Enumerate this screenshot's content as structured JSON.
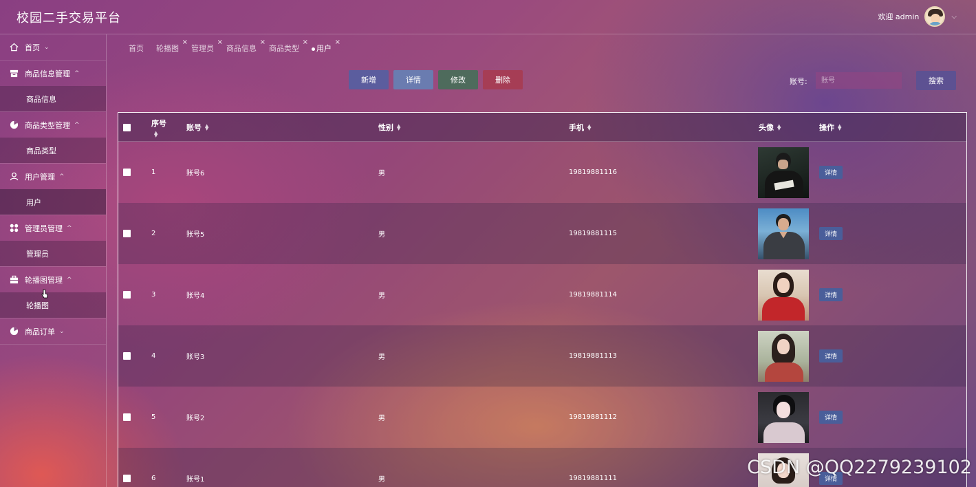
{
  "header": {
    "title": "校园二手交易平台",
    "welcome": "欢迎 admin"
  },
  "sidebar": {
    "items": [
      {
        "label": "首页",
        "icon": "home-icon",
        "expanded": false,
        "children": []
      },
      {
        "label": "商品信息管理",
        "icon": "box-icon",
        "expanded": true,
        "children": [
          "商品信息"
        ]
      },
      {
        "label": "商品类型管理",
        "icon": "pie-icon",
        "expanded": true,
        "children": [
          "商品类型"
        ]
      },
      {
        "label": "用户管理",
        "icon": "user-icon",
        "expanded": true,
        "children": [
          "用户"
        ]
      },
      {
        "label": "管理员管理",
        "icon": "grid-icon",
        "expanded": true,
        "children": [
          "管理员"
        ]
      },
      {
        "label": "轮播图管理",
        "icon": "briefcase-icon",
        "expanded": true,
        "children": [
          "轮播图"
        ]
      },
      {
        "label": "商品订单",
        "icon": "pie-icon",
        "expanded": false,
        "children": []
      }
    ]
  },
  "tabs": [
    {
      "label": "首页",
      "closable": false,
      "active": false
    },
    {
      "label": "轮播图",
      "closable": true,
      "active": false
    },
    {
      "label": "管理员",
      "closable": true,
      "active": false
    },
    {
      "label": "商品信息",
      "closable": true,
      "active": false
    },
    {
      "label": "商品类型",
      "closable": true,
      "active": false
    },
    {
      "label": "用户",
      "closable": true,
      "active": true
    }
  ],
  "toolbar": {
    "add": "新增",
    "detail": "详情",
    "edit": "修改",
    "delete": "删除"
  },
  "search": {
    "label": "账号:",
    "placeholder": "账号",
    "button": "搜索"
  },
  "table": {
    "columns": [
      "序号",
      "账号",
      "性别",
      "手机",
      "头像",
      "操作"
    ],
    "detail_label": "详情",
    "rows": [
      {
        "index": "1",
        "account": "账号6",
        "gender": "男",
        "phone": "19819881116"
      },
      {
        "index": "2",
        "account": "账号5",
        "gender": "男",
        "phone": "19819881115"
      },
      {
        "index": "3",
        "account": "账号4",
        "gender": "男",
        "phone": "19819881114"
      },
      {
        "index": "4",
        "account": "账号3",
        "gender": "男",
        "phone": "19819881113"
      },
      {
        "index": "5",
        "account": "账号2",
        "gender": "男",
        "phone": "19819881112"
      },
      {
        "index": "6",
        "account": "账号1",
        "gender": "男",
        "phone": "19819881111"
      }
    ]
  },
  "watermark": "CSDN @QQ2279239102"
}
